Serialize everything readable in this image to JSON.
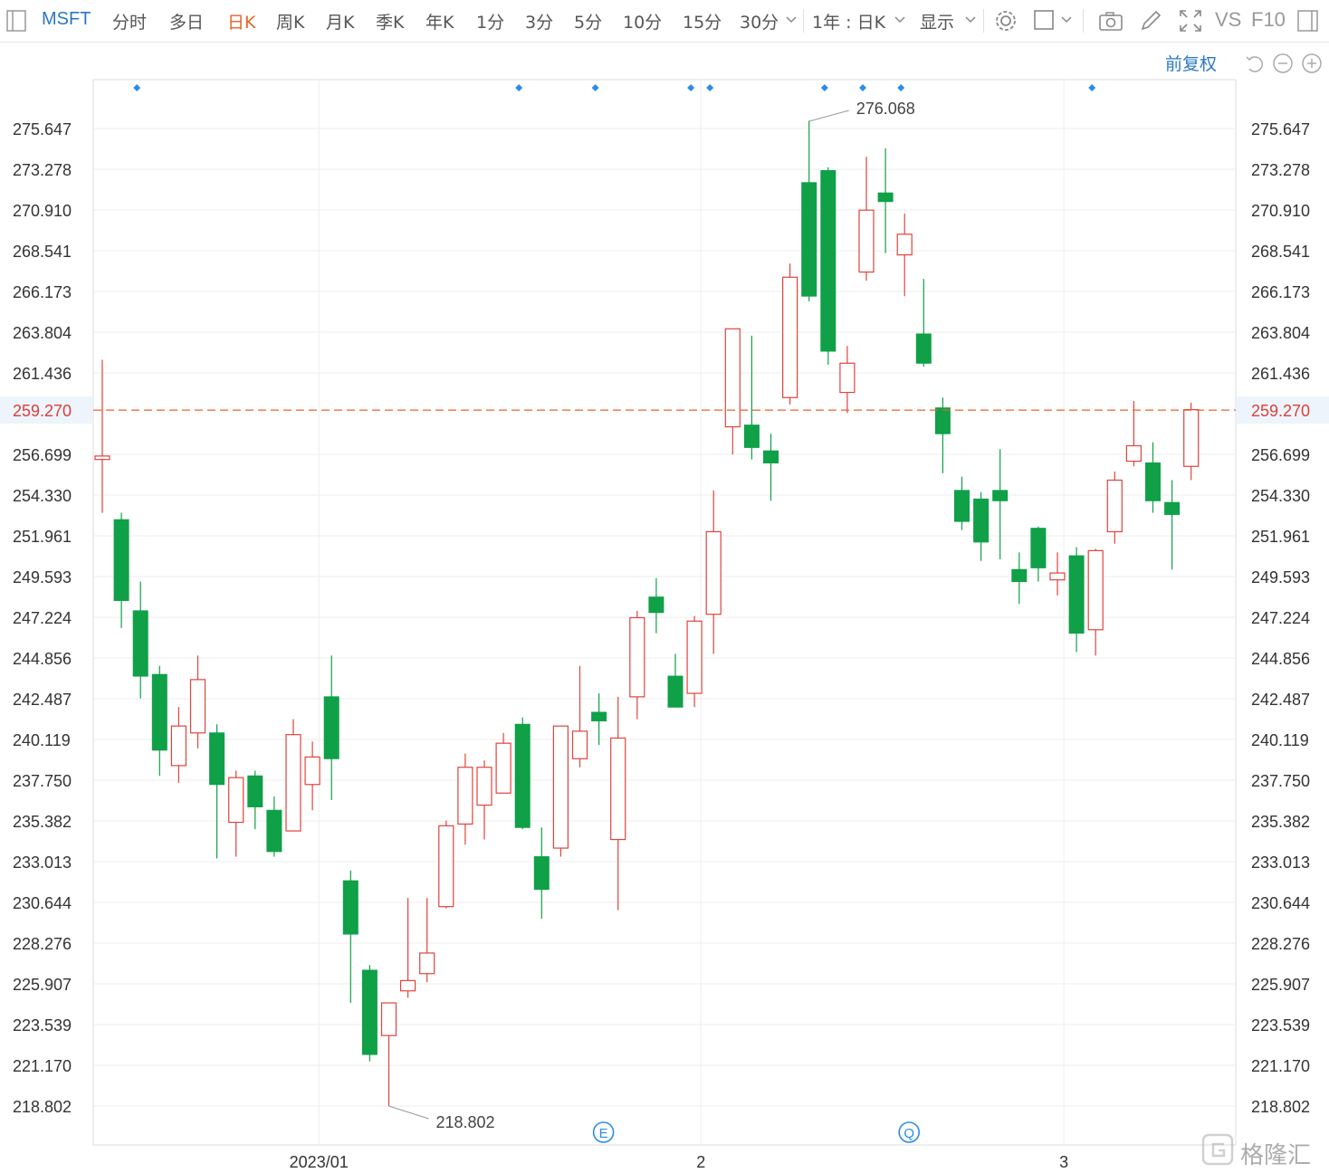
{
  "toolbar": {
    "symbol": "MSFT",
    "periods": [
      "分时",
      "多日",
      "日K",
      "周K",
      "月K",
      "季K",
      "年K",
      "1分",
      "3分",
      "5分",
      "10分",
      "15分",
      "30分"
    ],
    "active_period": "日K",
    "range_select": "1年 : 日K",
    "display_select": "显示",
    "vs_label": "VS",
    "f10_label": "F10"
  },
  "sub_toolbar": {
    "restore_label": "前复权"
  },
  "watermark": {
    "text": "格隆汇"
  },
  "colors": {
    "up": "#e0433c",
    "down": "#0fa048",
    "last_price": "#e8632a",
    "marker": "#2a8de6",
    "grid": "#eeeeee",
    "axis_text": "#333333"
  },
  "chart_data": {
    "type": "candlestick",
    "y_ticks": [
      "275.647",
      "273.278",
      "270.910",
      "268.541",
      "266.173",
      "263.804",
      "261.436",
      "259.270",
      "256.699",
      "254.330",
      "251.961",
      "249.593",
      "247.224",
      "244.856",
      "242.487",
      "240.119",
      "237.750",
      "235.382",
      "233.013",
      "230.644",
      "228.276",
      "225.907",
      "223.539",
      "221.170",
      "218.802"
    ],
    "ylim": [
      217.0,
      278.0
    ],
    "x_labels": [
      {
        "label": "2023/01",
        "index": 12
      },
      {
        "label": "2",
        "index": 32
      },
      {
        "label": "3",
        "index": 51
      }
    ],
    "last_price": 259.27,
    "max_label": "276.068",
    "min_label": "218.802",
    "max_index": 37,
    "min_index": 15,
    "event_markers": [
      {
        "label": "E",
        "index": 26
      },
      {
        "label": "Q",
        "index": 42
      }
    ],
    "dividend_markers": [
      2,
      22,
      26,
      31,
      32,
      38,
      40,
      42,
      52
    ],
    "candles": [
      {
        "o": 256.4,
        "h": 262.2,
        "l": 253.3,
        "c": 256.6
      },
      {
        "o": 252.9,
        "h": 253.3,
        "l": 246.6,
        "c": 248.2
      },
      {
        "o": 247.6,
        "h": 249.3,
        "l": 242.5,
        "c": 243.8
      },
      {
        "o": 243.9,
        "h": 244.4,
        "l": 238.0,
        "c": 239.5
      },
      {
        "o": 238.6,
        "h": 242.0,
        "l": 237.6,
        "c": 240.9
      },
      {
        "o": 240.5,
        "h": 245.0,
        "l": 239.6,
        "c": 243.6
      },
      {
        "o": 240.5,
        "h": 241.0,
        "l": 233.2,
        "c": 237.5
      },
      {
        "o": 235.3,
        "h": 238.3,
        "l": 233.3,
        "c": 237.9
      },
      {
        "o": 238.0,
        "h": 238.3,
        "l": 234.9,
        "c": 236.2
      },
      {
        "o": 236.0,
        "h": 236.8,
        "l": 233.3,
        "c": 233.6
      },
      {
        "o": 234.8,
        "h": 241.3,
        "l": 234.8,
        "c": 240.4
      },
      {
        "o": 237.5,
        "h": 240.0,
        "l": 236.0,
        "c": 239.1
      },
      {
        "o": 242.6,
        "h": 245.0,
        "l": 236.6,
        "c": 239.0
      },
      {
        "o": 231.9,
        "h": 232.5,
        "l": 224.8,
        "c": 228.8
      },
      {
        "o": 226.7,
        "h": 227.0,
        "l": 221.4,
        "c": 221.8
      },
      {
        "o": 222.9,
        "h": 223.6,
        "l": 218.8,
        "c": 224.8
      },
      {
        "o": 225.5,
        "h": 230.9,
        "l": 225.1,
        "c": 226.1
      },
      {
        "o": 226.5,
        "h": 230.9,
        "l": 226.0,
        "c": 227.7
      },
      {
        "o": 230.4,
        "h": 235.4,
        "l": 230.3,
        "c": 235.1
      },
      {
        "o": 235.2,
        "h": 239.3,
        "l": 234.0,
        "c": 238.5
      },
      {
        "o": 236.3,
        "h": 238.9,
        "l": 234.3,
        "c": 238.5
      },
      {
        "o": 237.0,
        "h": 240.5,
        "l": 237.0,
        "c": 239.9
      },
      {
        "o": 241.0,
        "h": 241.4,
        "l": 234.9,
        "c": 235.0
      },
      {
        "o": 233.3,
        "h": 235.0,
        "l": 229.7,
        "c": 231.4
      },
      {
        "o": 233.8,
        "h": 240.3,
        "l": 233.3,
        "c": 240.9
      },
      {
        "o": 239.0,
        "h": 244.4,
        "l": 238.5,
        "c": 240.6
      },
      {
        "o": 241.7,
        "h": 242.8,
        "l": 239.8,
        "c": 241.2
      },
      {
        "o": 234.3,
        "h": 242.6,
        "l": 230.2,
        "c": 240.2
      },
      {
        "o": 242.6,
        "h": 247.6,
        "l": 241.3,
        "c": 247.2
      },
      {
        "o": 248.4,
        "h": 249.5,
        "l": 246.3,
        "c": 247.5
      },
      {
        "o": 243.8,
        "h": 245.1,
        "l": 242.1,
        "c": 242.0
      },
      {
        "o": 242.8,
        "h": 247.3,
        "l": 242.0,
        "c": 247.0
      },
      {
        "o": 247.4,
        "h": 254.6,
        "l": 245.1,
        "c": 252.2
      },
      {
        "o": 258.3,
        "h": 264.0,
        "l": 256.7,
        "c": 264.0
      },
      {
        "o": 258.4,
        "h": 263.6,
        "l": 256.4,
        "c": 257.1
      },
      {
        "o": 256.9,
        "h": 257.9,
        "l": 254.0,
        "c": 256.2
      },
      {
        "o": 260.0,
        "h": 267.8,
        "l": 259.6,
        "c": 267.0
      },
      {
        "o": 272.5,
        "h": 276.1,
        "l": 265.6,
        "c": 265.9
      },
      {
        "o": 273.2,
        "h": 273.4,
        "l": 261.9,
        "c": 262.7
      },
      {
        "o": 260.3,
        "h": 263.0,
        "l": 259.1,
        "c": 262.0
      },
      {
        "o": 267.3,
        "h": 274.0,
        "l": 266.8,
        "c": 270.9
      },
      {
        "o": 271.9,
        "h": 274.5,
        "l": 268.4,
        "c": 271.4
      },
      {
        "o": 268.3,
        "h": 270.7,
        "l": 265.9,
        "c": 269.5
      },
      {
        "o": 263.7,
        "h": 266.9,
        "l": 261.8,
        "c": 262.0
      },
      {
        "o": 259.4,
        "h": 260.0,
        "l": 255.6,
        "c": 257.9
      },
      {
        "o": 254.6,
        "h": 255.4,
        "l": 252.3,
        "c": 252.8
      },
      {
        "o": 254.1,
        "h": 254.5,
        "l": 250.5,
        "c": 251.6
      },
      {
        "o": 254.6,
        "h": 257.0,
        "l": 250.6,
        "c": 254.0
      },
      {
        "o": 250.0,
        "h": 251.0,
        "l": 248.0,
        "c": 249.3
      },
      {
        "o": 252.4,
        "h": 252.5,
        "l": 249.3,
        "c": 250.1
      },
      {
        "o": 249.4,
        "h": 251.0,
        "l": 248.5,
        "c": 249.8
      },
      {
        "o": 250.8,
        "h": 251.3,
        "l": 245.2,
        "c": 246.3
      },
      {
        "o": 246.5,
        "h": 251.2,
        "l": 245.0,
        "c": 251.1
      },
      {
        "o": 252.2,
        "h": 255.7,
        "l": 251.5,
        "c": 255.2
      },
      {
        "o": 256.3,
        "h": 259.8,
        "l": 256.0,
        "c": 257.2
      },
      {
        "o": 256.2,
        "h": 257.4,
        "l": 253.3,
        "c": 254.0
      },
      {
        "o": 253.9,
        "h": 255.2,
        "l": 250.0,
        "c": 253.2
      },
      {
        "o": 256.0,
        "h": 259.7,
        "l": 255.2,
        "c": 259.3
      }
    ]
  }
}
